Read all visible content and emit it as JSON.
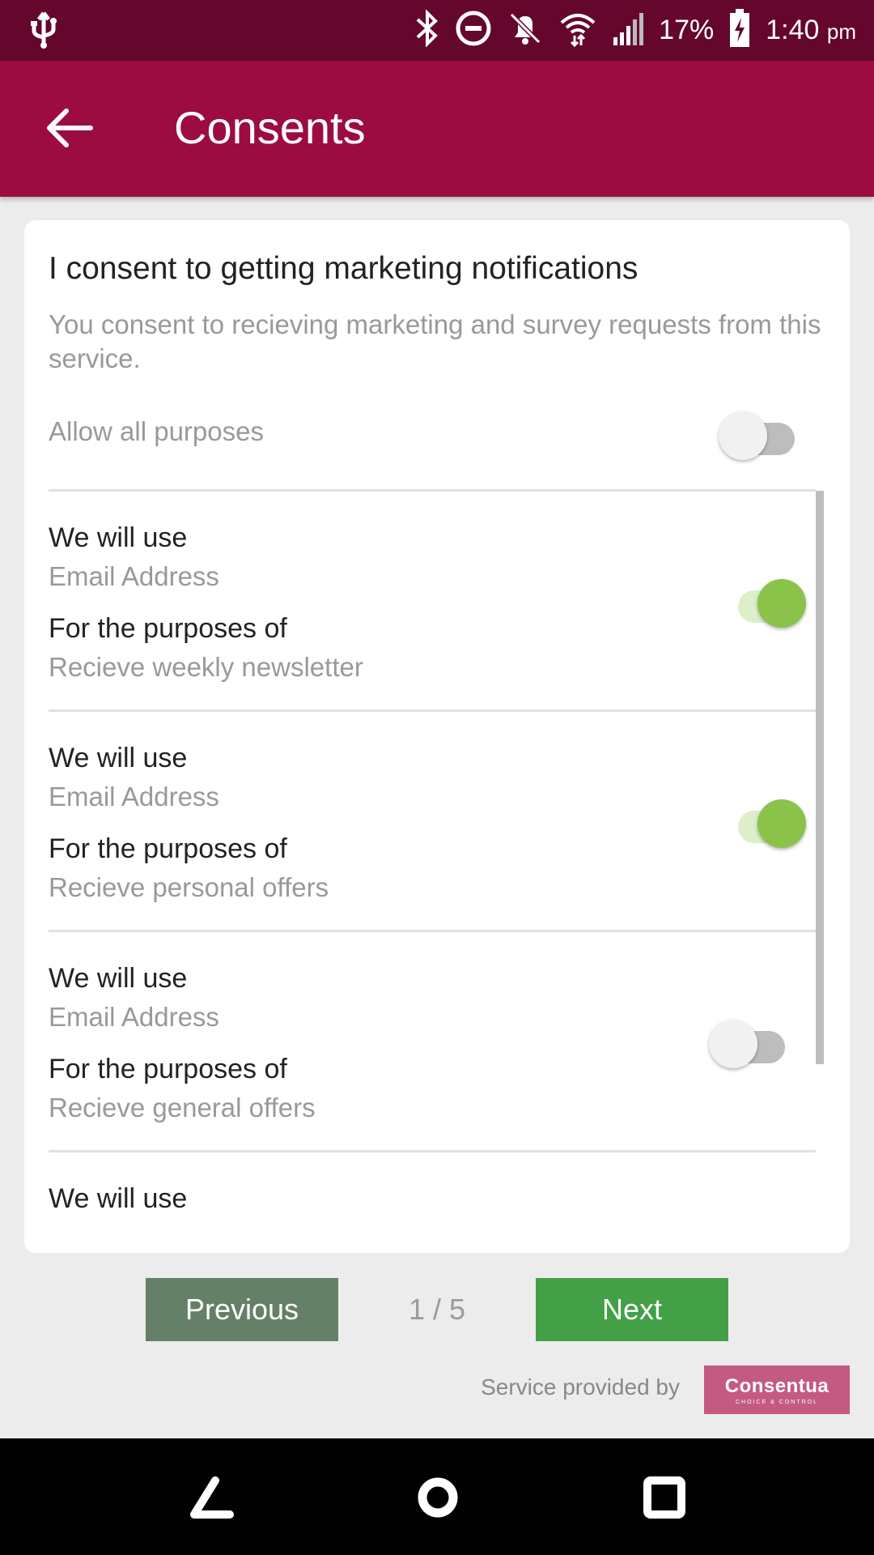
{
  "status_bar": {
    "battery_percent": "17%",
    "time": "1:40",
    "time_suffix": "pm",
    "icons": [
      "usb-icon",
      "bluetooth-icon",
      "do-not-disturb-icon",
      "notifications-off-icon",
      "wifi-icon",
      "signal-icon",
      "battery-charging-icon"
    ]
  },
  "app_bar": {
    "title": "Consents",
    "back_icon": "arrow-back-icon"
  },
  "card": {
    "title": "I consent to getting marketing notifications",
    "description": "You consent to recieving marketing and survey requests from this service.",
    "allow_all_label": "Allow all purposes",
    "allow_all_on": false,
    "items": [
      {
        "use_label": "We will use",
        "use_value": "Email Address",
        "purpose_label": "For the purposes of",
        "purpose_value": "Recieve weekly newsletter",
        "on": true
      },
      {
        "use_label": "We will use",
        "use_value": "Email Address",
        "purpose_label": "For the purposes of",
        "purpose_value": "Recieve personal offers",
        "on": true
      },
      {
        "use_label": "We will use",
        "use_value": "Email Address",
        "purpose_label": "For the purposes of",
        "purpose_value": "Recieve general offers",
        "on": false
      },
      {
        "use_label": "We will use"
      }
    ]
  },
  "pager": {
    "previous_label": "Previous",
    "page_indicator": "1 / 5",
    "next_label": "Next"
  },
  "footer": {
    "service_text": "Service provided by",
    "logo_name": "Consentua",
    "logo_tagline": "CHOICE & CONTROL"
  },
  "colors": {
    "status_bar": "#65062d",
    "app_bar": "#9c0c41",
    "toggle_on": "#8bc34a",
    "previous_button": "#658068",
    "next_button": "#43a047",
    "logo_bg": "#c45a82"
  }
}
